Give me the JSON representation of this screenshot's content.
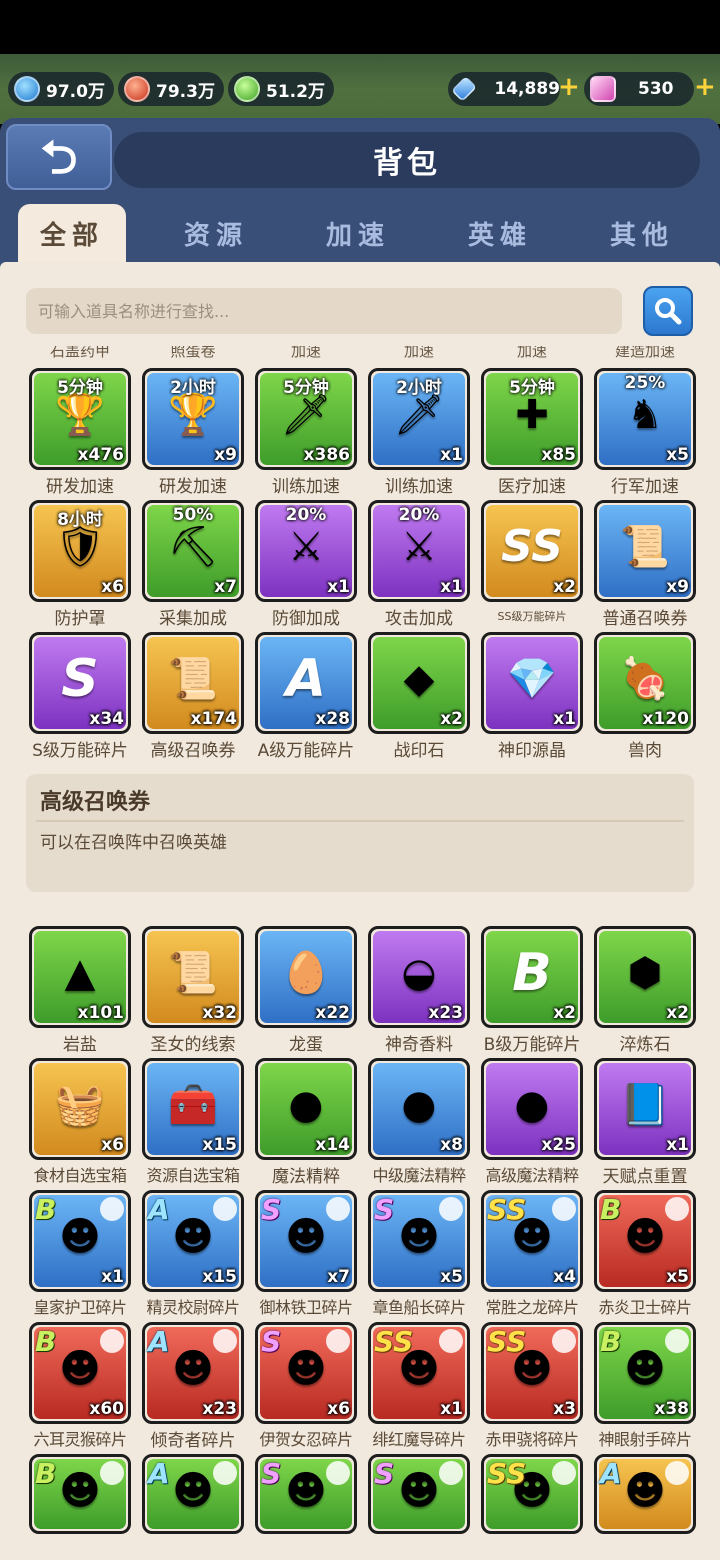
{
  "resources": {
    "blue": "97.0万",
    "red": "79.3万",
    "green": "51.2万",
    "gems": "14,889",
    "crystal": "530"
  },
  "header": {
    "title": "背包"
  },
  "tabs": [
    "全部",
    "资源",
    "加速",
    "英雄",
    "其他"
  ],
  "search": {
    "placeholder": "可输入道具名称进行查找..."
  },
  "cutoff_labels": [
    "石盖药甲",
    "照蛋卷",
    "加速",
    "加速",
    "加速",
    "建造加速"
  ],
  "rows": [
    [
      {
        "badge": "5分钟",
        "qty": "x476",
        "label": "研发加速",
        "color": "g-green",
        "icon": "🏆"
      },
      {
        "badge": "2小时",
        "qty": "x9",
        "label": "研发加速",
        "color": "g-blue",
        "icon": "🏆"
      },
      {
        "badge": "5分钟",
        "qty": "x386",
        "label": "训练加速",
        "color": "g-green",
        "icon": "🗡"
      },
      {
        "badge": "2小时",
        "qty": "x1",
        "label": "训练加速",
        "color": "g-blue",
        "icon": "🗡"
      },
      {
        "badge": "5分钟",
        "qty": "x85",
        "label": "医疗加速",
        "color": "g-green",
        "icon": "✚"
      },
      {
        "badge": "25%",
        "qty": "x5",
        "label": "行军加速",
        "color": "g-blue",
        "icon": "♞"
      }
    ],
    [
      {
        "badge": "8小时",
        "qty": "x6",
        "label": "防护罩",
        "color": "g-orange",
        "icon": "🛡"
      },
      {
        "badge": "50%",
        "qty": "x7",
        "label": "采集加成",
        "color": "g-green",
        "icon": "⛏"
      },
      {
        "badge": "20%",
        "qty": "x1",
        "label": "防御加成",
        "color": "g-purple",
        "icon": "⚔"
      },
      {
        "badge": "20%",
        "qty": "x1",
        "label": "攻击加成",
        "color": "g-purple",
        "icon": "⚔"
      },
      {
        "badge": "",
        "qty": "x2",
        "label": "SS级万能碎片",
        "color": "g-orange",
        "icon": "SS",
        "small": true
      },
      {
        "badge": "",
        "qty": "x9",
        "label": "普通召唤券",
        "color": "g-blue",
        "icon": "📜"
      }
    ],
    [
      {
        "badge": "",
        "qty": "x34",
        "label": "S级万能碎片",
        "color": "g-purple",
        "icon": "S"
      },
      {
        "badge": "",
        "qty": "x174",
        "label": "高级召唤券",
        "color": "g-orange",
        "icon": "📜"
      },
      {
        "badge": "",
        "qty": "x28",
        "label": "A级万能碎片",
        "color": "g-blue",
        "icon": "A"
      },
      {
        "badge": "",
        "qty": "x2",
        "label": "战印石",
        "color": "g-green",
        "icon": "◆"
      },
      {
        "badge": "",
        "qty": "x1",
        "label": "神印源晶",
        "color": "g-purple",
        "icon": "💎"
      },
      {
        "badge": "",
        "qty": "x120",
        "label": "兽肉",
        "color": "g-green",
        "icon": "🍖"
      }
    ],
    [
      {
        "badge": "",
        "qty": "x101",
        "label": "岩盐",
        "color": "g-green",
        "icon": "▲"
      },
      {
        "badge": "",
        "qty": "x32",
        "label": "圣女的线索",
        "color": "g-orange",
        "icon": "📜"
      },
      {
        "badge": "",
        "qty": "x22",
        "label": "龙蛋",
        "color": "g-blue",
        "icon": "🥚"
      },
      {
        "badge": "",
        "qty": "x23",
        "label": "神奇香料",
        "color": "g-purple",
        "icon": "◒"
      },
      {
        "badge": "",
        "qty": "x2",
        "label": "B级万能碎片",
        "color": "g-green",
        "icon": "B"
      },
      {
        "badge": "",
        "qty": "x2",
        "label": "淬炼石",
        "color": "g-green",
        "icon": "⬢"
      }
    ],
    [
      {
        "badge": "",
        "qty": "x6",
        "label": "食材自选宝箱",
        "color": "g-orange",
        "icon": "🧺",
        "tight": true
      },
      {
        "badge": "",
        "qty": "x15",
        "label": "资源自选宝箱",
        "color": "g-blue",
        "icon": "🧰",
        "tight": true
      },
      {
        "badge": "",
        "qty": "x14",
        "label": "魔法精粹",
        "color": "g-green",
        "icon": "●"
      },
      {
        "badge": "",
        "qty": "x8",
        "label": "中级魔法精粹",
        "color": "g-blue",
        "icon": "●",
        "tight": true
      },
      {
        "badge": "",
        "qty": "x25",
        "label": "高级魔法精粹",
        "color": "g-purple",
        "icon": "●",
        "tight": true
      },
      {
        "badge": "",
        "qty": "x1",
        "label": "天赋点重置",
        "color": "g-purple",
        "icon": "📘"
      }
    ],
    [
      {
        "grade": "B",
        "qty": "x1",
        "label": "皇家护卫碎片",
        "color": "g-blue",
        "icon": "☻",
        "tight": true
      },
      {
        "grade": "A",
        "qty": "x15",
        "label": "精灵校尉碎片",
        "color": "g-blue",
        "icon": "☻",
        "tight": true
      },
      {
        "grade": "S",
        "qty": "x7",
        "label": "御林铁卫碎片",
        "color": "g-blue",
        "icon": "☻",
        "tight": true
      },
      {
        "grade": "S",
        "qty": "x5",
        "label": "章鱼船长碎片",
        "color": "g-blue",
        "icon": "☻",
        "tight": true
      },
      {
        "grade": "SS",
        "qty": "x4",
        "label": "常胜之龙碎片",
        "color": "g-blue",
        "icon": "☻",
        "tight": true
      },
      {
        "grade": "B",
        "qty": "x5",
        "label": "赤炎卫士碎片",
        "color": "g-red",
        "icon": "☻",
        "tight": true
      }
    ],
    [
      {
        "grade": "B",
        "qty": "x60",
        "label": "六耳灵猴碎片",
        "color": "g-red",
        "icon": "☻",
        "tight": true
      },
      {
        "grade": "A",
        "qty": "x23",
        "label": "倾奇者碎片",
        "color": "g-red",
        "icon": "☻"
      },
      {
        "grade": "S",
        "qty": "x6",
        "label": "伊贺女忍碎片",
        "color": "g-red",
        "icon": "☻",
        "tight": true
      },
      {
        "grade": "SS",
        "qty": "x1",
        "label": "绯红魔导碎片",
        "color": "g-red",
        "icon": "☻",
        "tight": true
      },
      {
        "grade": "SS",
        "qty": "x3",
        "label": "赤甲骁将碎片",
        "color": "g-red",
        "icon": "☻",
        "tight": true
      },
      {
        "grade": "B",
        "qty": "x38",
        "label": "神眼射手碎片",
        "color": "g-green",
        "icon": "☻",
        "tight": true
      }
    ],
    [
      {
        "grade": "B",
        "qty": "",
        "label": "",
        "color": "g-green",
        "icon": "☻"
      },
      {
        "grade": "A",
        "qty": "",
        "label": "",
        "color": "g-green",
        "icon": "☻"
      },
      {
        "grade": "S",
        "qty": "",
        "label": "",
        "color": "g-green",
        "icon": "☻"
      },
      {
        "grade": "S",
        "qty": "",
        "label": "",
        "color": "g-green",
        "icon": "☻"
      },
      {
        "grade": "SS",
        "qty": "",
        "label": "",
        "color": "g-green",
        "icon": "☻"
      },
      {
        "grade": "A",
        "qty": "",
        "label": "",
        "color": "g-orange",
        "icon": "☻"
      }
    ]
  ],
  "description": {
    "title": "高级召唤券",
    "text": "可以在召唤阵中召唤英雄"
  }
}
